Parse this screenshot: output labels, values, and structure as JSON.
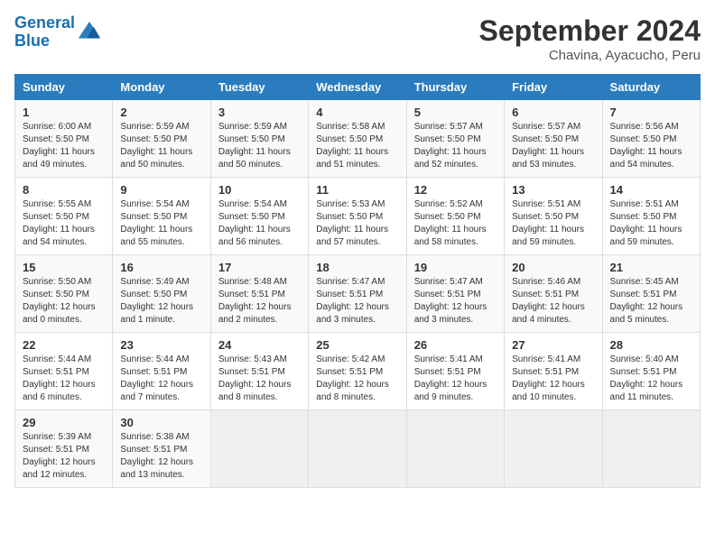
{
  "header": {
    "logo_line1": "General",
    "logo_line2": "Blue",
    "title": "September 2024",
    "subtitle": "Chavina, Ayacucho, Peru"
  },
  "weekdays": [
    "Sunday",
    "Monday",
    "Tuesday",
    "Wednesday",
    "Thursday",
    "Friday",
    "Saturday"
  ],
  "weeks": [
    [
      {
        "day": "1",
        "sunrise": "6:00 AM",
        "sunset": "5:50 PM",
        "hours": "11 hours",
        "mins": "49 minutes"
      },
      {
        "day": "2",
        "sunrise": "5:59 AM",
        "sunset": "5:50 PM",
        "hours": "11 hours",
        "mins": "50 minutes"
      },
      {
        "day": "3",
        "sunrise": "5:59 AM",
        "sunset": "5:50 PM",
        "hours": "11 hours",
        "mins": "50 minutes"
      },
      {
        "day": "4",
        "sunrise": "5:58 AM",
        "sunset": "5:50 PM",
        "hours": "11 hours",
        "mins": "51 minutes"
      },
      {
        "day": "5",
        "sunrise": "5:57 AM",
        "sunset": "5:50 PM",
        "hours": "11 hours",
        "mins": "52 minutes"
      },
      {
        "day": "6",
        "sunrise": "5:57 AM",
        "sunset": "5:50 PM",
        "hours": "11 hours",
        "mins": "53 minutes"
      },
      {
        "day": "7",
        "sunrise": "5:56 AM",
        "sunset": "5:50 PM",
        "hours": "11 hours",
        "mins": "54 minutes"
      }
    ],
    [
      {
        "day": "8",
        "sunrise": "5:55 AM",
        "sunset": "5:50 PM",
        "hours": "11 hours",
        "mins": "54 minutes"
      },
      {
        "day": "9",
        "sunrise": "5:54 AM",
        "sunset": "5:50 PM",
        "hours": "11 hours",
        "mins": "55 minutes"
      },
      {
        "day": "10",
        "sunrise": "5:54 AM",
        "sunset": "5:50 PM",
        "hours": "11 hours",
        "mins": "56 minutes"
      },
      {
        "day": "11",
        "sunrise": "5:53 AM",
        "sunset": "5:50 PM",
        "hours": "11 hours",
        "mins": "57 minutes"
      },
      {
        "day": "12",
        "sunrise": "5:52 AM",
        "sunset": "5:50 PM",
        "hours": "11 hours",
        "mins": "58 minutes"
      },
      {
        "day": "13",
        "sunrise": "5:51 AM",
        "sunset": "5:50 PM",
        "hours": "11 hours",
        "mins": "59 minutes"
      },
      {
        "day": "14",
        "sunrise": "5:51 AM",
        "sunset": "5:50 PM",
        "hours": "11 hours",
        "mins": "59 minutes"
      }
    ],
    [
      {
        "day": "15",
        "sunrise": "5:50 AM",
        "sunset": "5:50 PM",
        "hours": "12 hours",
        "mins": "0 minutes"
      },
      {
        "day": "16",
        "sunrise": "5:49 AM",
        "sunset": "5:50 PM",
        "hours": "12 hours",
        "mins": "1 minute"
      },
      {
        "day": "17",
        "sunrise": "5:48 AM",
        "sunset": "5:51 PM",
        "hours": "12 hours",
        "mins": "2 minutes"
      },
      {
        "day": "18",
        "sunrise": "5:47 AM",
        "sunset": "5:51 PM",
        "hours": "12 hours",
        "mins": "3 minutes"
      },
      {
        "day": "19",
        "sunrise": "5:47 AM",
        "sunset": "5:51 PM",
        "hours": "12 hours",
        "mins": "3 minutes"
      },
      {
        "day": "20",
        "sunrise": "5:46 AM",
        "sunset": "5:51 PM",
        "hours": "12 hours",
        "mins": "4 minutes"
      },
      {
        "day": "21",
        "sunrise": "5:45 AM",
        "sunset": "5:51 PM",
        "hours": "12 hours",
        "mins": "5 minutes"
      }
    ],
    [
      {
        "day": "22",
        "sunrise": "5:44 AM",
        "sunset": "5:51 PM",
        "hours": "12 hours",
        "mins": "6 minutes"
      },
      {
        "day": "23",
        "sunrise": "5:44 AM",
        "sunset": "5:51 PM",
        "hours": "12 hours",
        "mins": "7 minutes"
      },
      {
        "day": "24",
        "sunrise": "5:43 AM",
        "sunset": "5:51 PM",
        "hours": "12 hours",
        "mins": "8 minutes"
      },
      {
        "day": "25",
        "sunrise": "5:42 AM",
        "sunset": "5:51 PM",
        "hours": "12 hours",
        "mins": "8 minutes"
      },
      {
        "day": "26",
        "sunrise": "5:41 AM",
        "sunset": "5:51 PM",
        "hours": "12 hours",
        "mins": "9 minutes"
      },
      {
        "day": "27",
        "sunrise": "5:41 AM",
        "sunset": "5:51 PM",
        "hours": "12 hours",
        "mins": "10 minutes"
      },
      {
        "day": "28",
        "sunrise": "5:40 AM",
        "sunset": "5:51 PM",
        "hours": "12 hours",
        "mins": "11 minutes"
      }
    ],
    [
      {
        "day": "29",
        "sunrise": "5:39 AM",
        "sunset": "5:51 PM",
        "hours": "12 hours",
        "mins": "12 minutes"
      },
      {
        "day": "30",
        "sunrise": "5:38 AM",
        "sunset": "5:51 PM",
        "hours": "12 hours",
        "mins": "13 minutes"
      },
      null,
      null,
      null,
      null,
      null
    ]
  ]
}
